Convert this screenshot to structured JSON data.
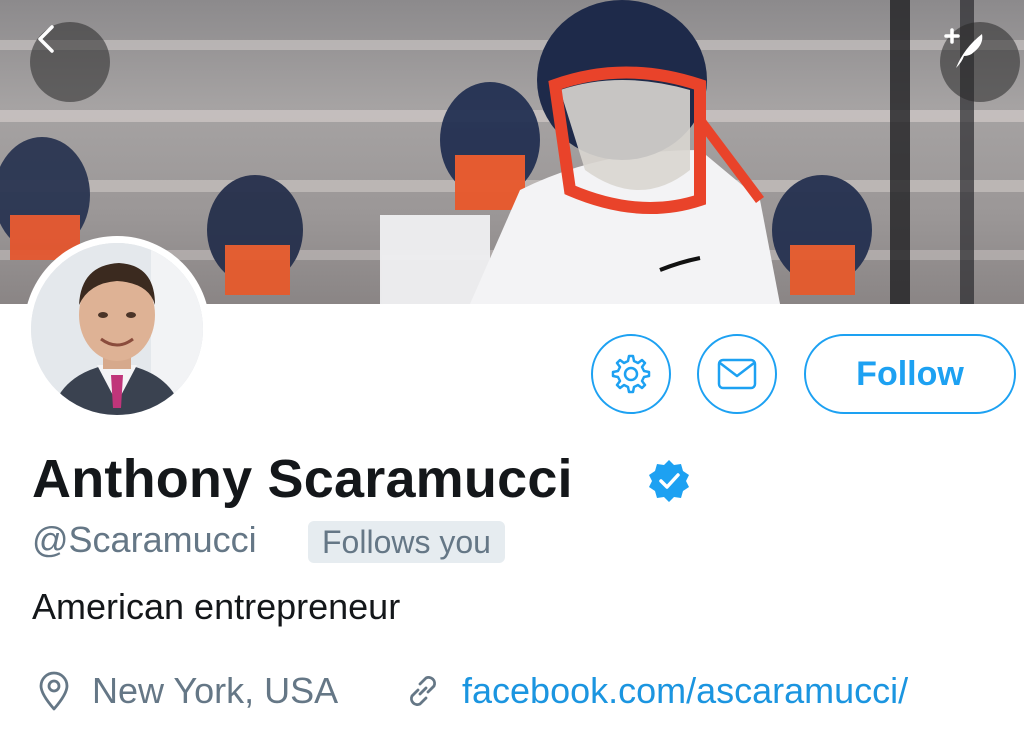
{
  "profile": {
    "display_name": "Anthony Scaramucci",
    "handle": "@Scaramucci",
    "follows_you_badge": "Follows you",
    "bio": "American entrepreneur",
    "location": "New York, USA",
    "website": "facebook.com/ascaramucci/",
    "verified": true
  },
  "actions": {
    "follow_label": "Follow",
    "settings_icon": "gear-icon",
    "message_icon": "envelope-icon"
  },
  "navigation": {
    "back_icon": "chevron-left-icon",
    "compose_icon": "compose-tweet-icon"
  },
  "colors": {
    "accent": "#1da1f2",
    "link": "#1b95e0",
    "secondary_text": "#657786",
    "primary_text": "#14171a",
    "badge_bg": "#e6ecf0"
  }
}
